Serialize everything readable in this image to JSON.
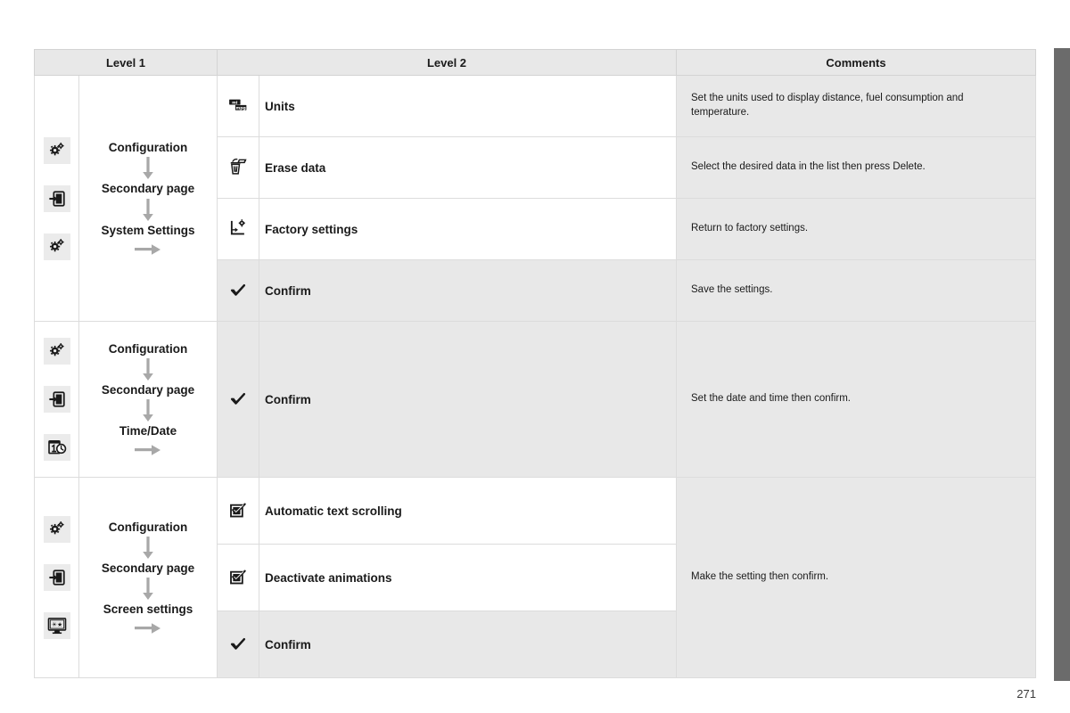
{
  "page": {
    "number": "271"
  },
  "table": {
    "headers": {
      "level1": "Level 1",
      "level2": "Level 2",
      "comments": "Comments"
    },
    "blocks": [
      {
        "id": "system-settings",
        "icons": [
          "gear-icon",
          "secondary-page-icon",
          "gear-icon"
        ],
        "flow": [
          "Configuration",
          "Secondary page",
          "System Settings"
        ],
        "rows": [
          {
            "icon": "units-icon",
            "label": "Units",
            "comment": "Set the units used to display distance, fuel consumption and temperature.",
            "shaded": false
          },
          {
            "icon": "trash-icon",
            "label": "Erase data",
            "comment": "Select the desired data in the list then press Delete.",
            "shaded": false
          },
          {
            "icon": "factory-reset-icon",
            "label": "Factory settings",
            "comment": "Return to factory settings.",
            "shaded": false
          },
          {
            "icon": "check-icon",
            "label": "Confirm",
            "comment": "Save the settings.",
            "shaded": true
          }
        ]
      },
      {
        "id": "time-date",
        "icons": [
          "gear-icon",
          "secondary-page-icon",
          "calendar-clock-icon"
        ],
        "flow": [
          "Configuration",
          "Secondary page",
          "Time/Date"
        ],
        "rows": [
          {
            "icon": "check-icon",
            "label": "Confirm",
            "comment": "Set the date and time then confirm.",
            "shaded": true
          }
        ]
      },
      {
        "id": "screen-settings",
        "icons": [
          "gear-icon",
          "secondary-page-icon",
          "monitor-icon"
        ],
        "flow": [
          "Configuration",
          "Secondary page",
          "Screen settings"
        ],
        "rows": [
          {
            "icon": "checkbox-icon",
            "label": "Automatic text scrolling",
            "comment": "Make the setting then confirm.",
            "shaded": false
          },
          {
            "icon": "checkbox-icon",
            "label": "Deactivate animations",
            "comment": "",
            "shaded": false
          },
          {
            "icon": "check-icon",
            "label": "Confirm",
            "comment": "",
            "shaded": true
          }
        ]
      }
    ]
  },
  "colors": {
    "header_bg": "#e8e8e8",
    "comment_bg": "#e8e8e8",
    "shaded_bg": "#e8e8e8",
    "border": "#dcdcdc",
    "text": "#1a1a1a",
    "edge_bar": "#6b6b6b",
    "icon_chip_bg": "#ebebeb",
    "arrow": "#a8a8a8"
  }
}
